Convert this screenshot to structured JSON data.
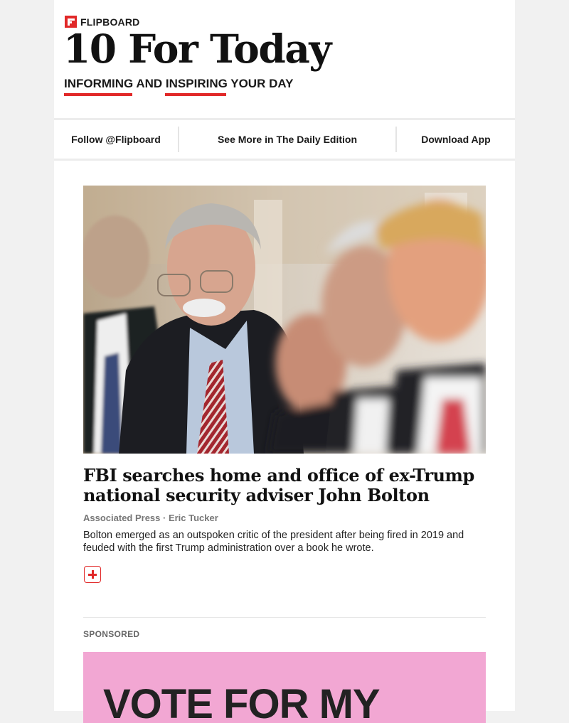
{
  "header": {
    "brand": "FLIPBOARD",
    "title": "10 For Today",
    "tagline": "INFORMING AND INSPIRING YOUR DAY"
  },
  "nav": {
    "follow": "Follow @Flipboard",
    "daily_edition": "See More in The Daily Edition",
    "download": "Download App"
  },
  "article": {
    "headline": "FBI searches home and office of ex-Trump national security adviser John Bolton",
    "byline": "Associated Press · Eric Tucker",
    "summary": "Bolton emerged as an outspoken critic of the president after being fired in 2019 and feuded with the first Trump administration over a book he wrote."
  },
  "sponsored": {
    "label": "SPONSORED",
    "ad_text": "VOTE FOR MY"
  },
  "colors": {
    "accent": "#e12828",
    "ad_background": "#f2a7d3"
  }
}
